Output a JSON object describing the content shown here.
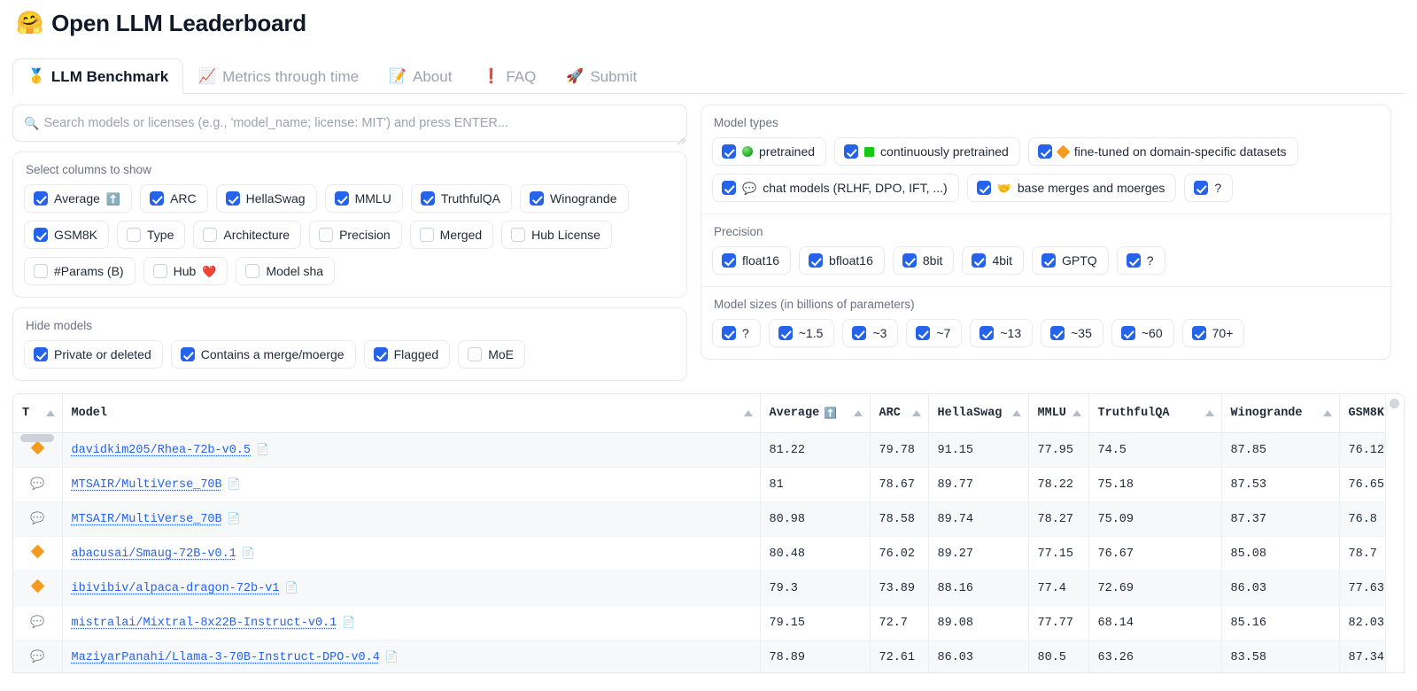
{
  "header": {
    "emoji": "🤗",
    "title": "Open LLM Leaderboard"
  },
  "tabs": [
    {
      "icon": "🥇",
      "label": "LLM Benchmark",
      "active": true
    },
    {
      "icon": "📈",
      "label": "Metrics through time",
      "active": false
    },
    {
      "icon": "📝",
      "label": "About",
      "active": false
    },
    {
      "icon": "❗",
      "label": "FAQ",
      "active": false
    },
    {
      "icon": "🚀",
      "label": "Submit",
      "active": false
    }
  ],
  "search": {
    "placeholder": "Search models or licenses (e.g., 'model_name; license: MIT') and press ENTER...",
    "value": "",
    "icon": "🔍"
  },
  "columns_panel": {
    "label": "Select columns to show",
    "rows": [
      [
        {
          "label": "Average",
          "suffix_icon": "⬆️",
          "checked": true
        },
        {
          "label": "ARC",
          "checked": true
        },
        {
          "label": "HellaSwag",
          "checked": true
        },
        {
          "label": "MMLU",
          "checked": true
        },
        {
          "label": "TruthfulQA",
          "checked": true
        },
        {
          "label": "Winogrande",
          "checked": true
        }
      ],
      [
        {
          "label": "GSM8K",
          "checked": true
        },
        {
          "label": "Type",
          "checked": false
        },
        {
          "label": "Architecture",
          "checked": false
        },
        {
          "label": "Precision",
          "checked": false
        },
        {
          "label": "Merged",
          "checked": false
        },
        {
          "label": "Hub License",
          "checked": false
        }
      ],
      [
        {
          "label": "#Params (B)",
          "checked": false
        },
        {
          "label": "Hub",
          "suffix_icon": "❤️",
          "checked": false
        },
        {
          "label": "Model sha",
          "checked": false
        }
      ]
    ]
  },
  "hide_panel": {
    "label": "Hide models",
    "items": [
      {
        "label": "Private or deleted",
        "checked": true
      },
      {
        "label": "Contains a merge/moerge",
        "checked": true
      },
      {
        "label": "Flagged",
        "checked": true
      },
      {
        "label": "MoE",
        "checked": false
      }
    ]
  },
  "model_types_panel": {
    "label": "Model types",
    "rows": [
      [
        {
          "shape": "dot-green",
          "label": "pretrained",
          "checked": true
        },
        {
          "shape": "sq-green",
          "label": "continuously pretrained",
          "checked": true
        },
        {
          "shape": "diamond",
          "label": "fine-tuned on domain-specific datasets",
          "checked": true
        }
      ],
      [
        {
          "shape": "emoji",
          "emoji": "💬",
          "label": "chat models (RLHF, DPO, IFT, ...)",
          "checked": true
        },
        {
          "shape": "emoji",
          "emoji": "🤝",
          "label": "base merges and moerges",
          "checked": true
        },
        {
          "shape": "none",
          "label": "?",
          "checked": true
        }
      ]
    ]
  },
  "precision_panel": {
    "label": "Precision",
    "items": [
      {
        "label": "float16",
        "checked": true
      },
      {
        "label": "bfloat16",
        "checked": true
      },
      {
        "label": "8bit",
        "checked": true
      },
      {
        "label": "4bit",
        "checked": true
      },
      {
        "label": "GPTQ",
        "checked": true
      },
      {
        "label": "?",
        "checked": true
      }
    ]
  },
  "sizes_panel": {
    "label": "Model sizes (in billions of parameters)",
    "items": [
      {
        "label": "?",
        "checked": true
      },
      {
        "label": "~1.5",
        "checked": true
      },
      {
        "label": "~3",
        "checked": true
      },
      {
        "label": "~7",
        "checked": true
      },
      {
        "label": "~13",
        "checked": true
      },
      {
        "label": "~35",
        "checked": true
      },
      {
        "label": "~60",
        "checked": true
      },
      {
        "label": "70+",
        "checked": true
      }
    ]
  },
  "table": {
    "headers": [
      {
        "label": "T",
        "sortable": true
      },
      {
        "label": "Model",
        "sortable": true
      },
      {
        "label": "Average",
        "suffix_icon": "⬆️",
        "sortable": true
      },
      {
        "label": "ARC",
        "sortable": true
      },
      {
        "label": "HellaSwag",
        "sortable": true
      },
      {
        "label": "MMLU",
        "sortable": true
      },
      {
        "label": "TruthfulQA",
        "sortable": true
      },
      {
        "label": "Winogrande",
        "sortable": true
      },
      {
        "label": "GSM8K",
        "sortable": true
      }
    ],
    "rows": [
      {
        "type": "diamond",
        "model": "davidkim205/Rhea-72b-v0.5",
        "doc": "📄",
        "average": "81.22",
        "arc": "79.78",
        "hellaswag": "91.15",
        "mmlu": "77.95",
        "truthfulqa": "74.5",
        "winogrande": "87.85",
        "gsm8k": "76.12"
      },
      {
        "type": "chat",
        "model": "MTSAIR/MultiVerse_70B",
        "doc": "📄",
        "average": "81",
        "arc": "78.67",
        "hellaswag": "89.77",
        "mmlu": "78.22",
        "truthfulqa": "75.18",
        "winogrande": "87.53",
        "gsm8k": "76.65"
      },
      {
        "type": "chat",
        "model": "MTSAIR/MultiVerse_70B",
        "doc": "📄",
        "average": "80.98",
        "arc": "78.58",
        "hellaswag": "89.74",
        "mmlu": "78.27",
        "truthfulqa": "75.09",
        "winogrande": "87.37",
        "gsm8k": "76.8"
      },
      {
        "type": "diamond",
        "model": "abacusai/Smaug-72B-v0.1",
        "doc": "📄",
        "average": "80.48",
        "arc": "76.02",
        "hellaswag": "89.27",
        "mmlu": "77.15",
        "truthfulqa": "76.67",
        "winogrande": "85.08",
        "gsm8k": "78.7"
      },
      {
        "type": "diamond",
        "model": "ibivibiv/alpaca-dragon-72b-v1",
        "doc": "📄",
        "average": "79.3",
        "arc": "73.89",
        "hellaswag": "88.16",
        "mmlu": "77.4",
        "truthfulqa": "72.69",
        "winogrande": "86.03",
        "gsm8k": "77.63"
      },
      {
        "type": "chat",
        "model": "mistralai/Mixtral-8x22B-Instruct-v0.1",
        "doc": "📄",
        "average": "79.15",
        "arc": "72.7",
        "hellaswag": "89.08",
        "mmlu": "77.77",
        "truthfulqa": "68.14",
        "winogrande": "85.16",
        "gsm8k": "82.03"
      },
      {
        "type": "chat",
        "model": "MaziyarPanahi/Llama-3-70B-Instruct-DPO-v0.4",
        "doc": "📄",
        "average": "78.89",
        "arc": "72.61",
        "hellaswag": "86.03",
        "mmlu": "80.5",
        "truthfulqa": "63.26",
        "winogrande": "83.58",
        "gsm8k": "87.34"
      }
    ]
  },
  "colors": {
    "accent_blue": "#2563eb",
    "link_blue": "#2563eb",
    "diamond_orange": "#f79b1e",
    "green": "#16a916",
    "border": "#e5e7eb"
  }
}
